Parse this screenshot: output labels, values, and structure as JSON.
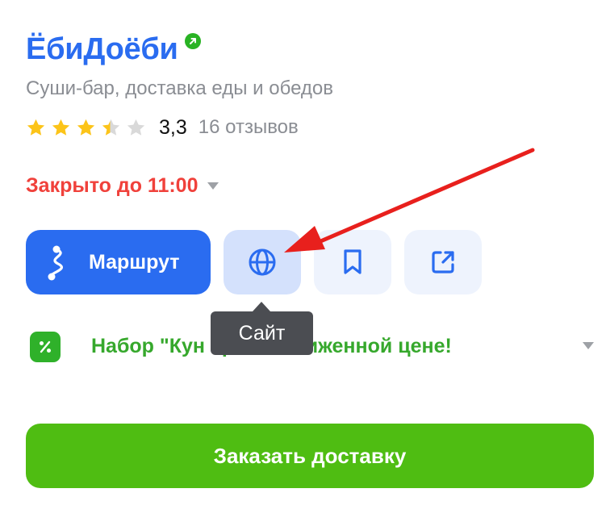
{
  "place": {
    "title": "ЁбиДоёби",
    "subtitle": "Суши-бар, доставка еды и обедов",
    "rating_value": "3,3",
    "rating_numeric": 3.3,
    "rating_max": 5,
    "reviews": "16 отзывов"
  },
  "status": {
    "text": "Закрыто до 11:00"
  },
  "actions": {
    "route_label": "Маршрут",
    "site_tooltip": "Сайт"
  },
  "promo": {
    "text": "Набор \"Кун           ерь по сниженной цене!"
  },
  "order": {
    "label": "Заказать доставку"
  },
  "colors": {
    "accent_blue": "#2a6cf0",
    "status_red": "#f0413b",
    "promo_green": "#36a82c",
    "order_green": "#4fbd12",
    "star_yellow": "#fcc419",
    "annotation_red": "#e8201d"
  },
  "icons": {
    "verified": "verified-arrow-icon",
    "route": "route-icon",
    "site": "globe-icon",
    "bookmark": "bookmark-icon",
    "share": "share-icon",
    "promo": "percent-icon"
  }
}
